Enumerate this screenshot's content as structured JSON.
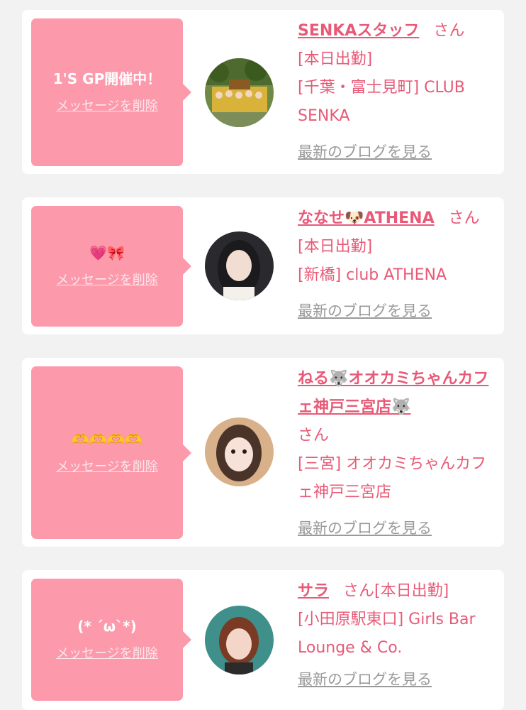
{
  "messages": [
    {
      "message": "1'S GP開催中！",
      "delete_label": "メッセージを削除",
      "name": "SENKAスタッフ",
      "suffix": "さん",
      "status": "[本日出勤]",
      "location": "[千葉・富士見町] CLUB SENKA",
      "blog_link": "最新のブログを見る"
    },
    {
      "message": "💗🎀",
      "delete_label": "メッセージを削除",
      "name": "ななせ🐶ATHENA",
      "suffix": "さん",
      "status": "[本日出勤]",
      "location": "[新橋] club ATHENA",
      "blog_link": "最新のブログを見る"
    },
    {
      "message": "🫶🫶🫶🫶",
      "delete_label": "メッセージを削除",
      "name": "ねる🐺オオカミちゃんカフェ神戸三宮店🐺",
      "suffix": "さん",
      "status": "",
      "location": "[三宮] オオカミちゃんカフェ神戸三宮店",
      "blog_link": "最新のブログを見る"
    },
    {
      "message": "(* ´ω`*)",
      "delete_label": "メッセージを削除",
      "name": "サラ",
      "suffix": "さん",
      "status": "[本日出勤]",
      "location": "[小田原駅東口] Girls Bar Lounge & Co.",
      "blog_link": "最新のブログを見る"
    }
  ]
}
